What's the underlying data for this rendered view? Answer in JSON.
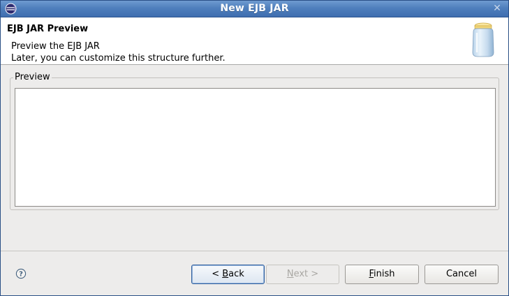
{
  "window": {
    "title": "New EJB JAR",
    "app_icon": "eclipse-icon",
    "close_icon": "close-icon",
    "close_glyph": "✕"
  },
  "header": {
    "title": "EJB JAR Preview",
    "description_line1": "Preview the EJB JAR",
    "description_line2": "Later, you can customize this structure further.",
    "banner_icon": "jar-icon"
  },
  "preview_group": {
    "label": "Preview"
  },
  "footer": {
    "help_icon": "help-icon",
    "buttons": {
      "back": {
        "prefix": "< ",
        "mnemonic": "B",
        "suffix": "ack",
        "enabled": true,
        "default": true
      },
      "next": {
        "prefix": "",
        "mnemonic": "N",
        "suffix": "ext >",
        "enabled": false
      },
      "finish": {
        "prefix": "",
        "mnemonic": "F",
        "suffix": "inish",
        "enabled": true
      },
      "cancel": {
        "label": "Cancel",
        "enabled": true
      }
    }
  },
  "colors": {
    "titlebar": "#4f7fbd",
    "dialog_bg": "#edeceb",
    "header_bg": "#ffffff",
    "default_button_border": "#2f5f9e",
    "disabled_text": "#a9a7a3"
  }
}
